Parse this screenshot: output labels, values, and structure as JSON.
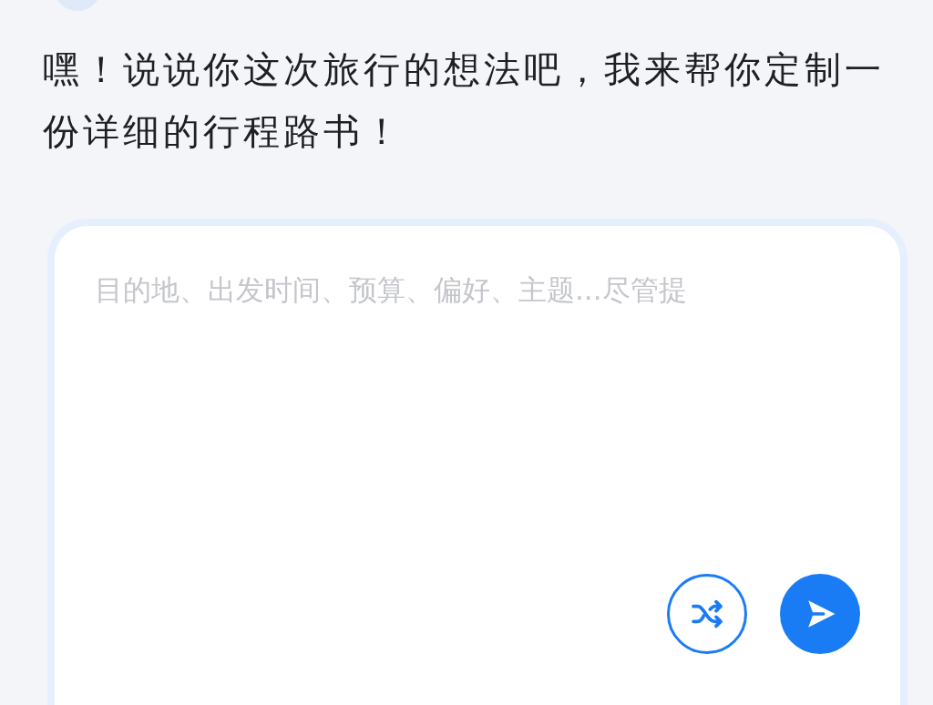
{
  "message": {
    "text": "嘿！说说你这次旅行的想法吧，我来帮你定制一份详细的行程路书！"
  },
  "composer": {
    "placeholder": "目的地、出发时间、预算、偏好、主题...尽管提"
  }
}
